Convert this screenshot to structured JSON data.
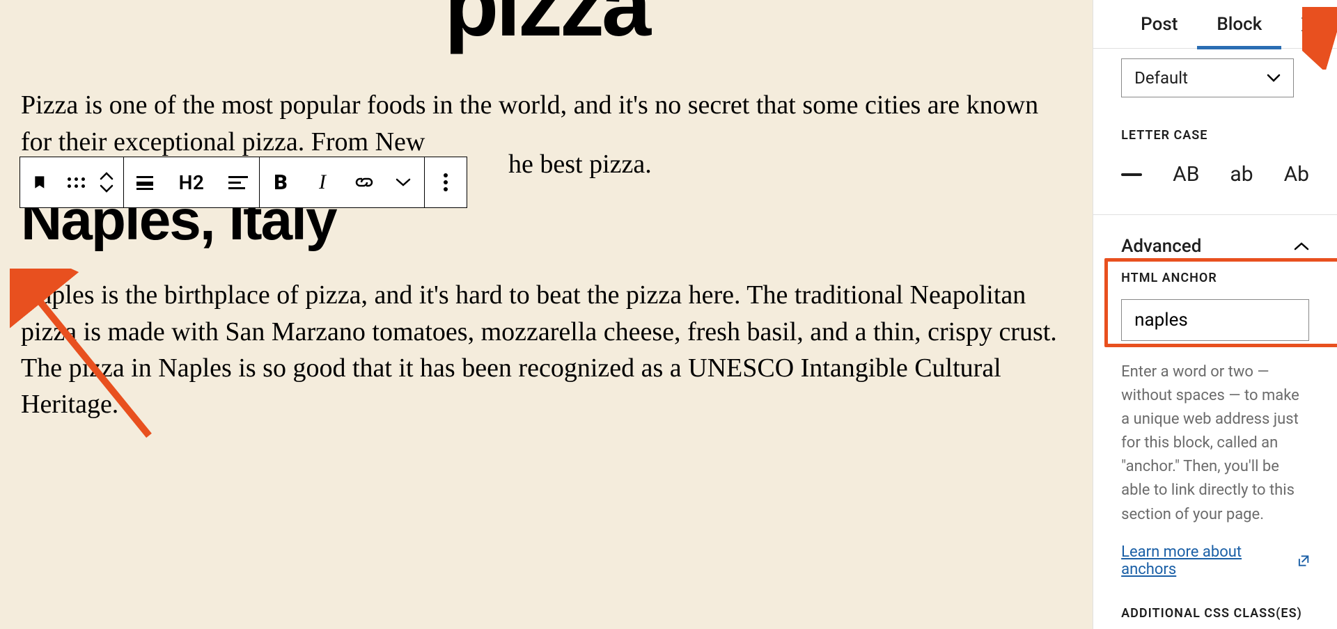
{
  "editor": {
    "title": "pizza",
    "paragraph1": "Pizza is one of the most popular foods in the world, and it's no secret that some cities are known for their exceptional pizza. From New",
    "paragraph1_tail": "he best pizza.",
    "heading": "Naples, Italy",
    "paragraph2": "Naples is the birthplace of pizza, and it's hard to beat the pizza here. The traditional Neapolitan pizza is made with San Marzano tomatoes, mozzarella cheese, fresh basil, and a thin, crispy crust. The pizza in Naples is so good that it has been recognized as a UNESCO Intangible Cultural Heritage."
  },
  "toolbar": {
    "heading_level": "H2"
  },
  "sidebar": {
    "tabs": {
      "post": "Post",
      "block": "Block"
    },
    "style_select": "Default",
    "lettercase": {
      "label": "LETTER CASE",
      "opts": [
        "AB",
        "ab",
        "Ab"
      ]
    },
    "advanced": {
      "title": "Advanced",
      "anchor_label": "HTML ANCHOR",
      "anchor_value": "naples",
      "help": "Enter a word or two — without spaces — to make a unique web address just for this block, called an \"anchor.\" Then, you'll be able to link directly to this section of your page.",
      "learn_more": "Learn more about anchors",
      "css_classes_label": "ADDITIONAL CSS CLASS(ES)"
    }
  }
}
